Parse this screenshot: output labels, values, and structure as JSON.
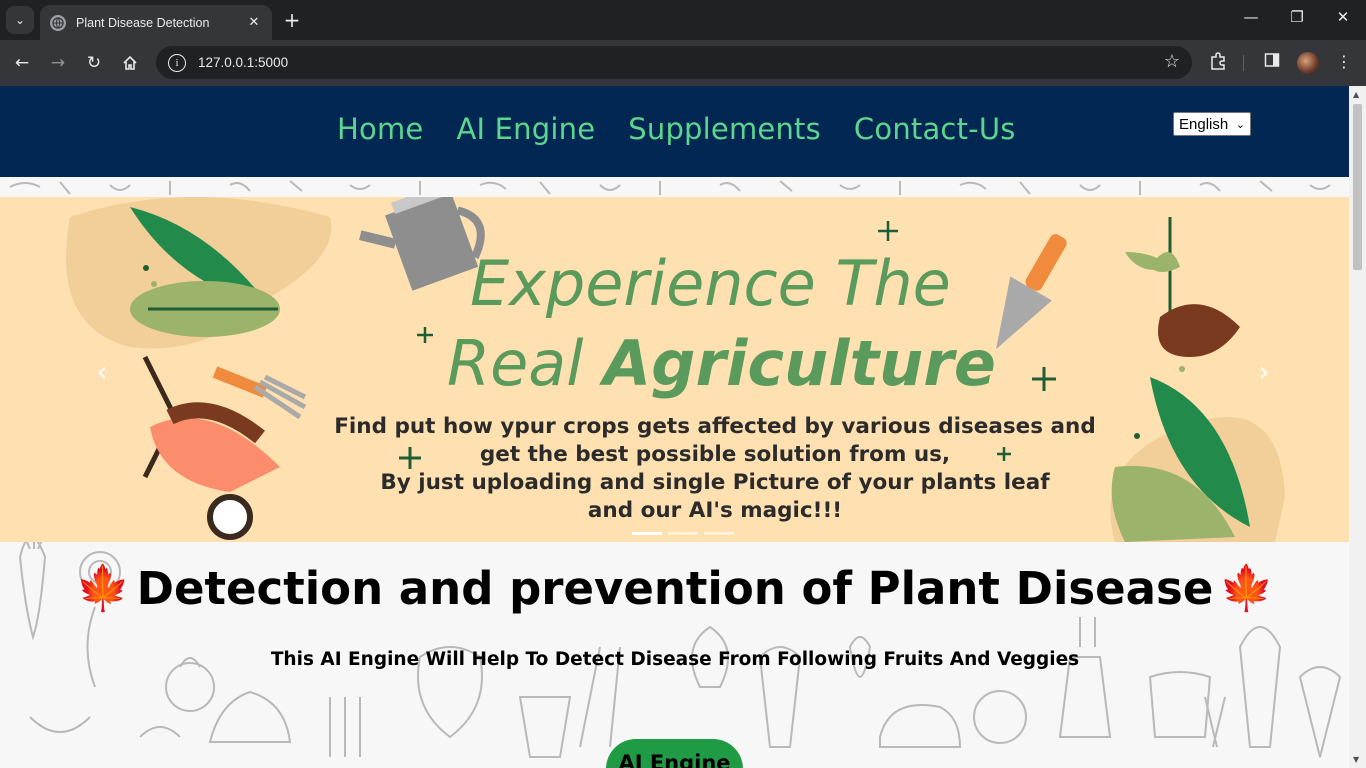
{
  "browser": {
    "tab_title": "Plant Disease Detection",
    "url": "127.0.0.1:5000"
  },
  "site": {
    "nav": [
      "Home",
      "AI Engine",
      "Supplements",
      "Contact-Us"
    ],
    "language": {
      "selected": "English"
    }
  },
  "banner": {
    "headline_1": "Experience The",
    "headline_2_regular": "Real ",
    "headline_2_bold": "Agriculture",
    "lines": [
      "Find put how ypur crops gets affected by various diseases and",
      "get the best possible solution from us,",
      "By just uploading and single Picture of your plants leaf",
      "and our AI's magic!!!"
    ],
    "active_slide": 1,
    "slide_count": 3
  },
  "main": {
    "title": "Detection and prevention of Plant Disease",
    "subtitle": "This AI Engine Will Help To Detect Disease From Following Fruits And Veggies",
    "cta_label": "AI Engine"
  },
  "colors": {
    "nav_bg": "#022752",
    "nav_link": "#5cd68e",
    "banner_bg": "#ffe0b0",
    "hero_text": "#5a9a5c",
    "cta_bg": "#1f9b45"
  },
  "icons": {
    "title_emoji": "maple-leaf-icon"
  }
}
